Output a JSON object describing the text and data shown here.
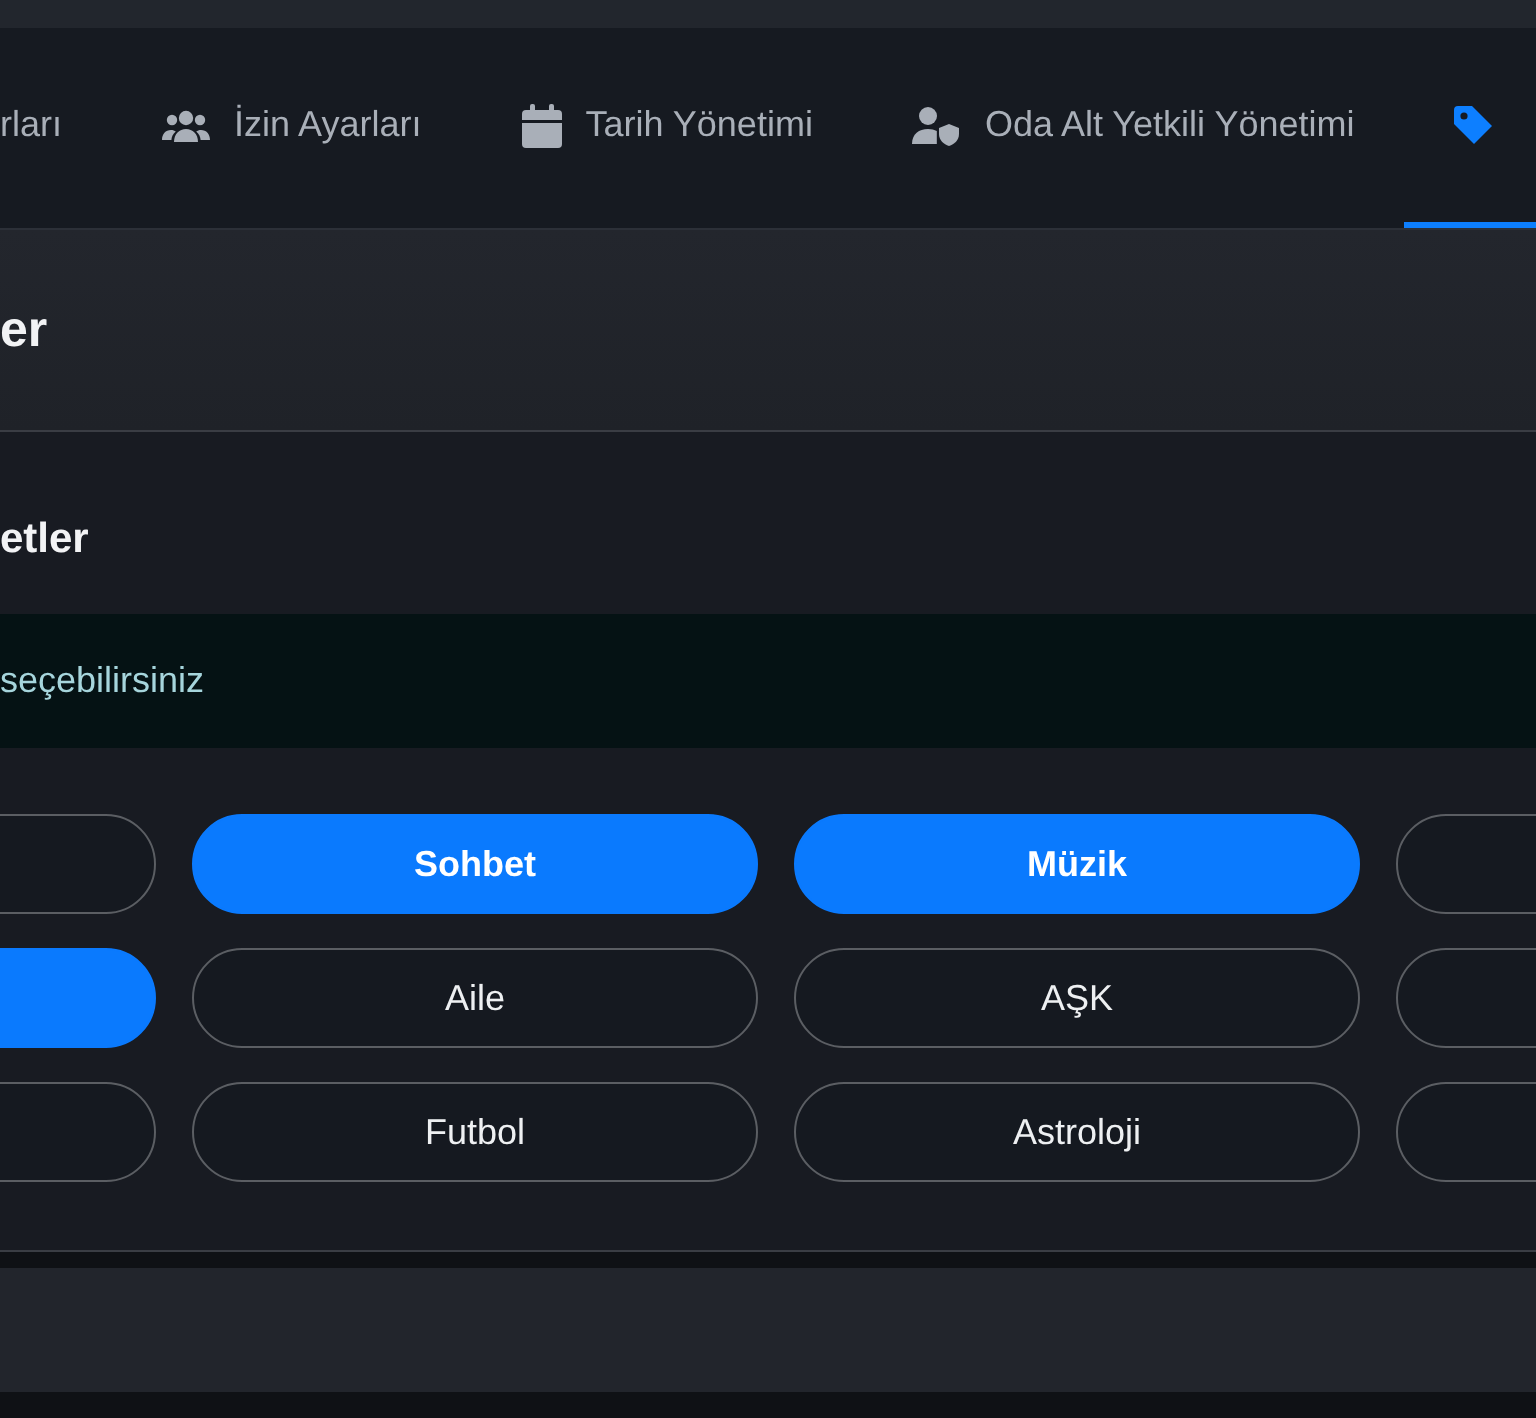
{
  "tabs": [
    {
      "label": "rları",
      "selected": false
    },
    {
      "kind": "users",
      "label": "İzin Ayarları",
      "selected": false
    },
    {
      "kind": "calendar",
      "label": "Tarih Yönetimi",
      "selected": false
    },
    {
      "kind": "user-shield",
      "label": "Oda Alt Yetkili Yönetimi",
      "selected": false
    },
    {
      "kind": "tag",
      "selected": true
    }
  ],
  "header": {
    "title": "er"
  },
  "card": {
    "title": "etler",
    "alert": "seçebilirsiniz",
    "tags": [
      {
        "selected": false
      },
      {
        "label": "Sohbet",
        "selected": true
      },
      {
        "label": "Müzik",
        "selected": true
      },
      {
        "selected": false
      },
      {
        "selected": true
      },
      {
        "label": "Aile",
        "selected": false
      },
      {
        "label": "AŞK",
        "selected": false
      },
      {
        "selected": false
      },
      {
        "selected": false
      },
      {
        "label": "Futbol",
        "selected": false
      },
      {
        "label": "Astroloji",
        "selected": false
      },
      {
        "selected": false
      }
    ]
  }
}
